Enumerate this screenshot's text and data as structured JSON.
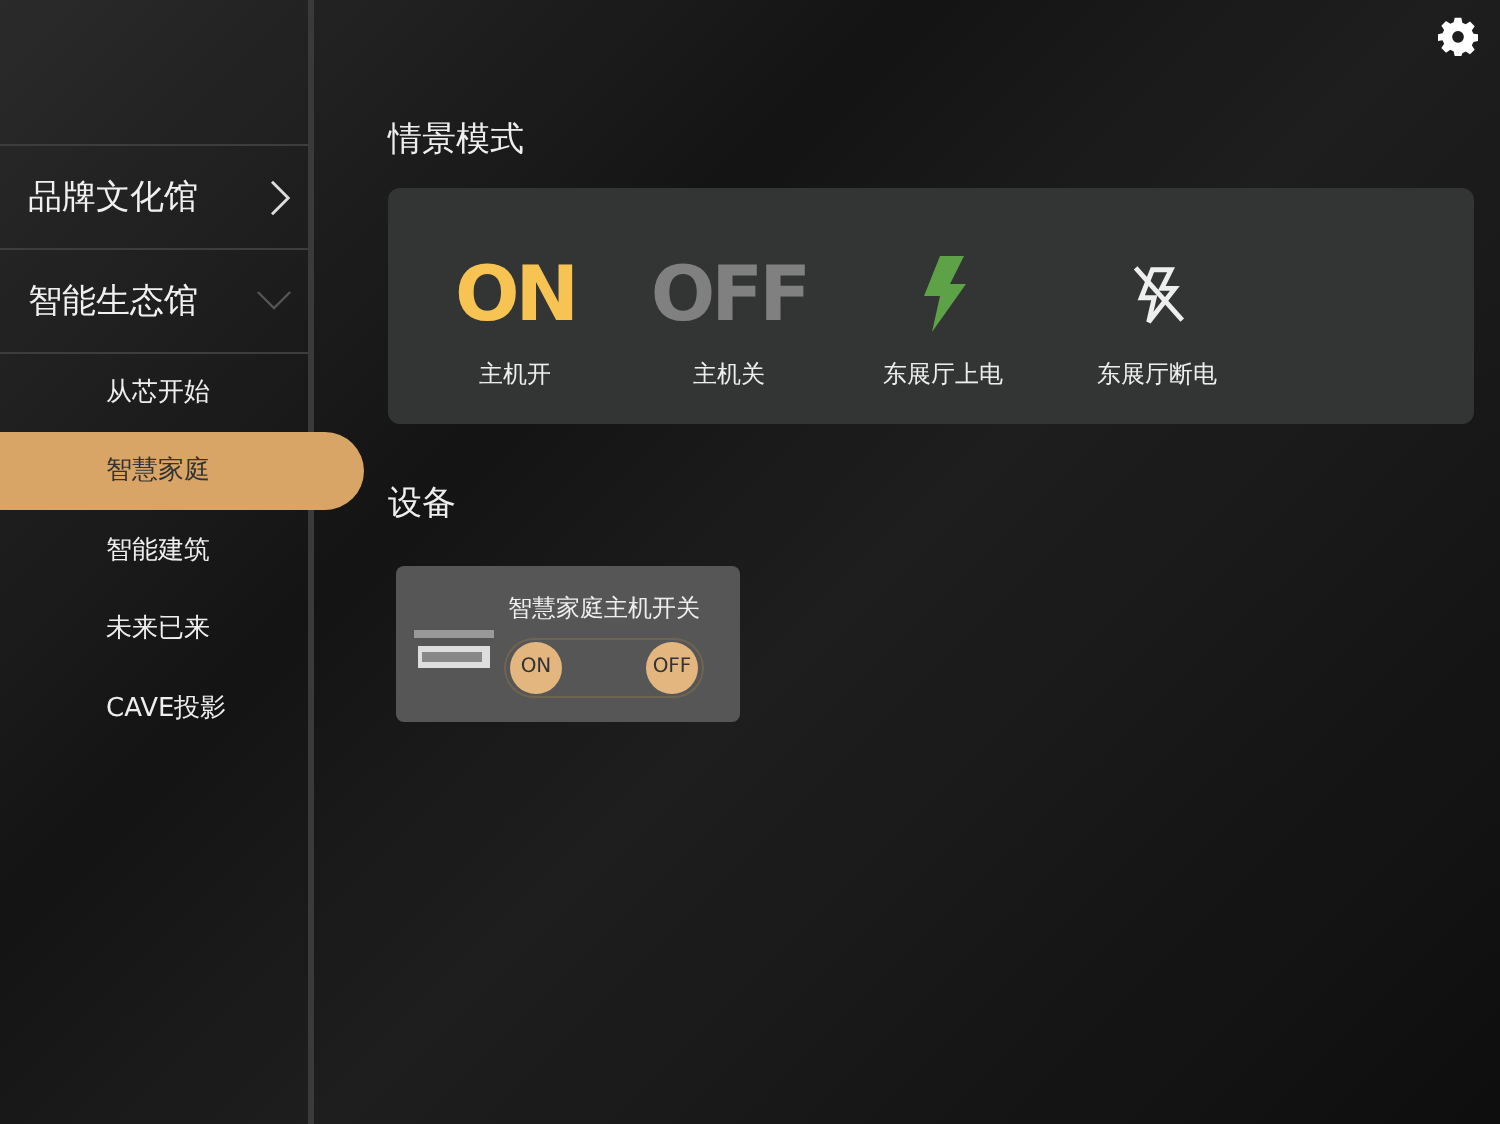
{
  "sidebar": {
    "groups": [
      {
        "label": "品牌文化馆",
        "expanded": false
      },
      {
        "label": "智能生态馆",
        "expanded": true,
        "children": [
          {
            "label": "从芯开始",
            "selected": false
          },
          {
            "label": "智慧家庭",
            "selected": true
          },
          {
            "label": "智能建筑",
            "selected": false
          },
          {
            "label": "未来已来",
            "selected": false
          },
          {
            "label": "CAVE投影",
            "selected": false
          }
        ]
      }
    ]
  },
  "scenes": {
    "title": "情景模式",
    "items": [
      {
        "kind": "on",
        "glyph": "ON",
        "label": "主机开"
      },
      {
        "kind": "off",
        "glyph": "OFF",
        "label": "主机关"
      },
      {
        "kind": "power",
        "label": "东展厅上电"
      },
      {
        "kind": "power-off",
        "label": "东展厅断电"
      }
    ]
  },
  "devices": {
    "title": "设备",
    "items": [
      {
        "name": "智慧家庭主机开关",
        "buttons": [
          "ON",
          "OFF"
        ]
      }
    ]
  }
}
